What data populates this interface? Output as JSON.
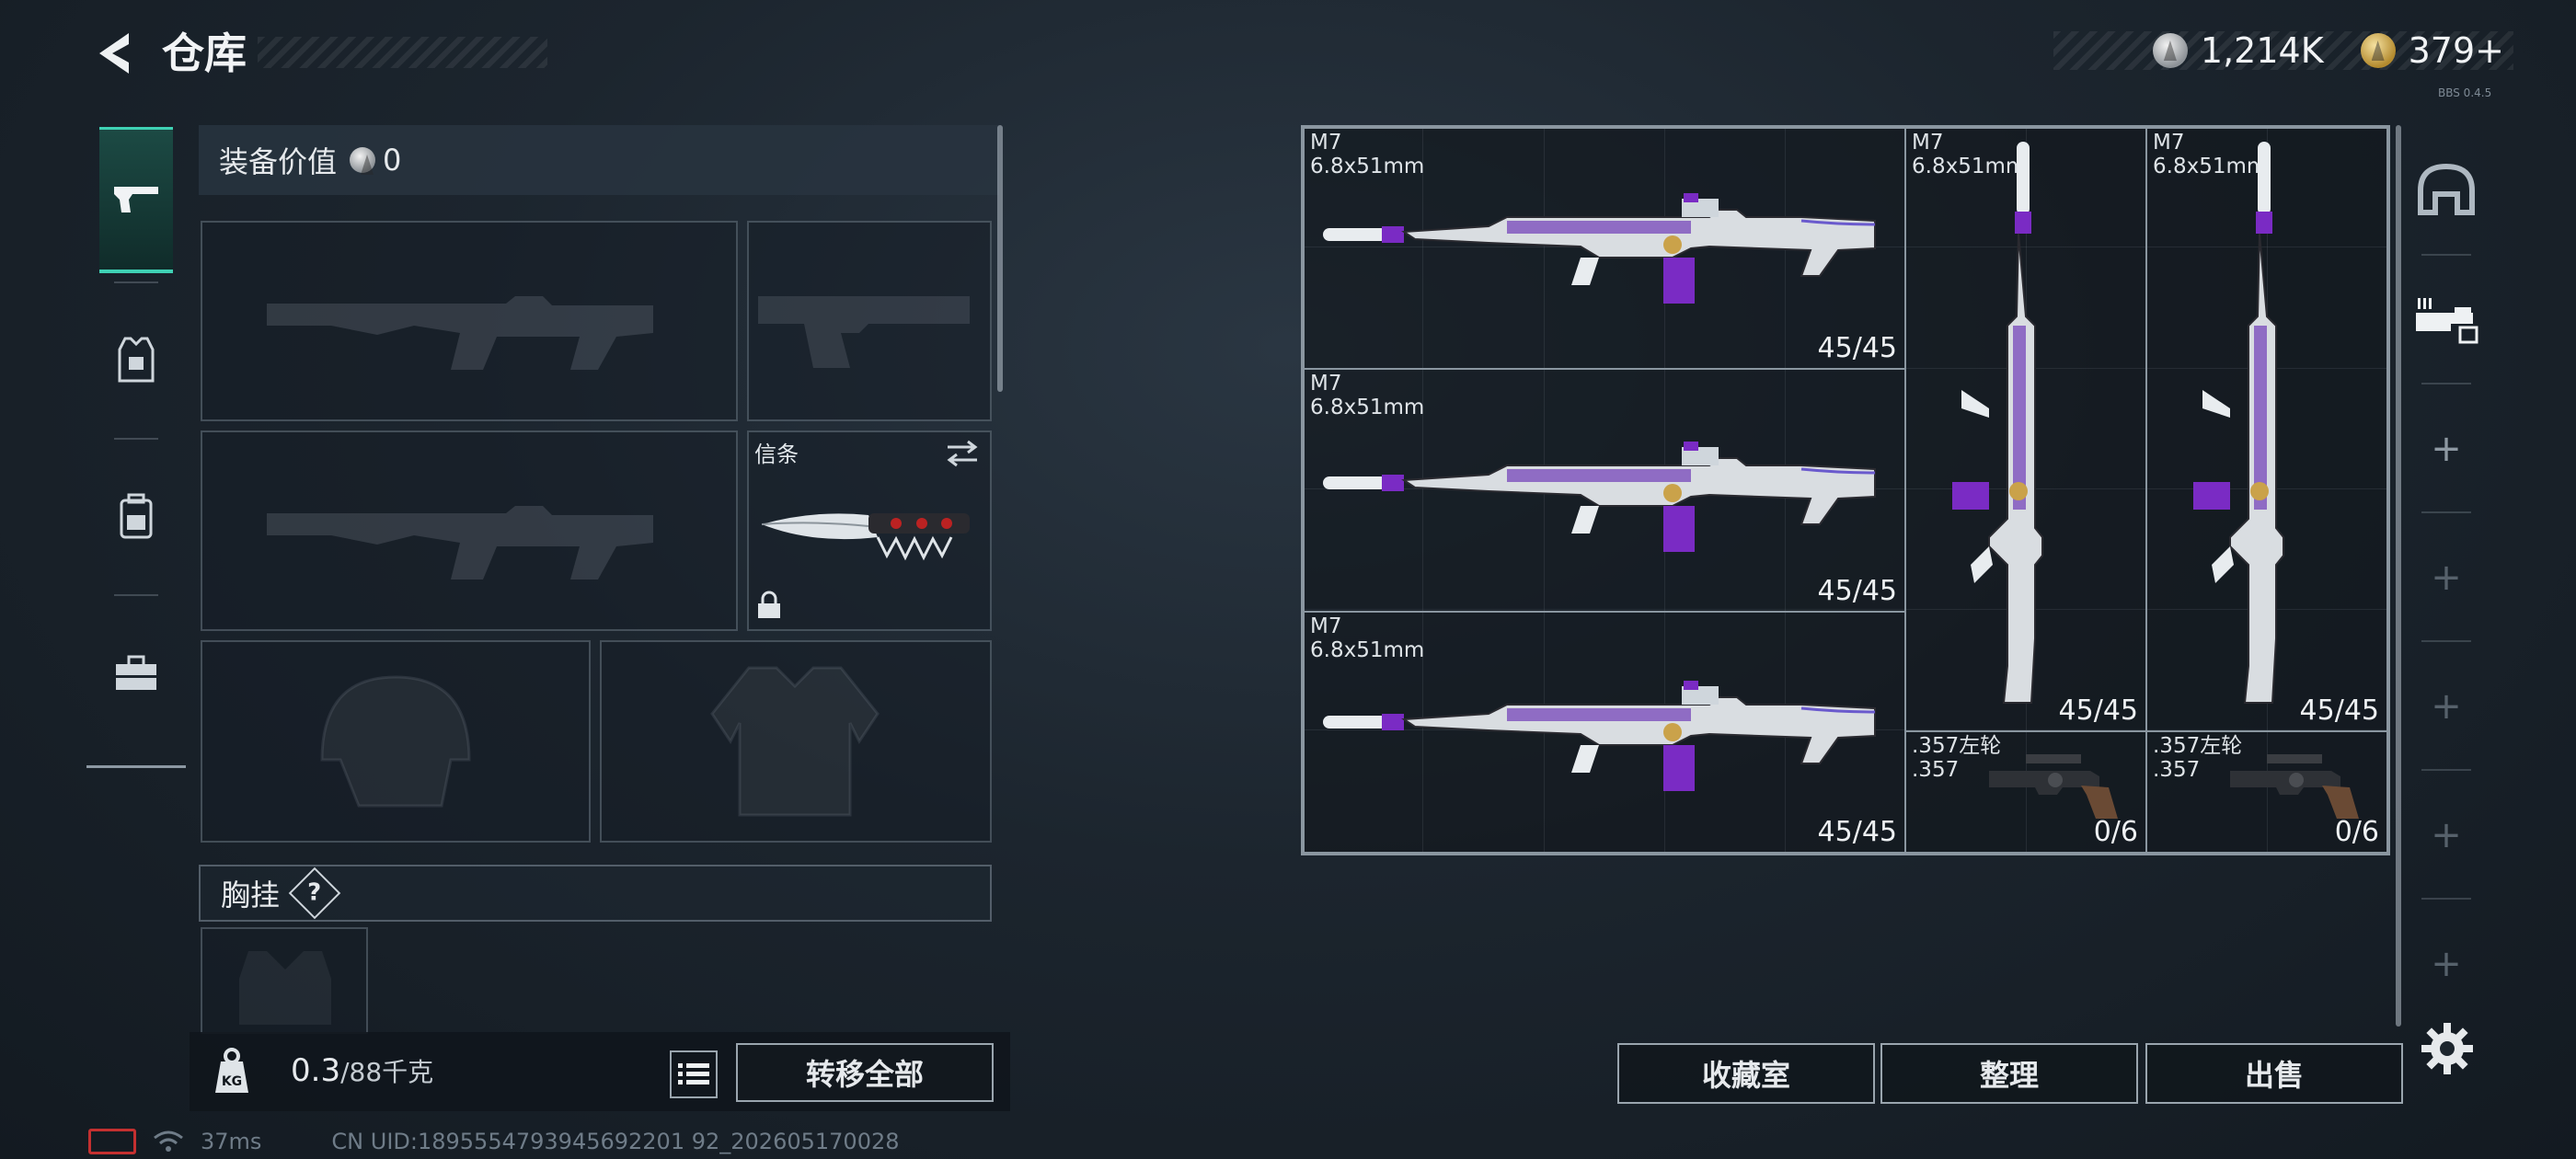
{
  "header": {
    "title": "仓库",
    "currencies": [
      {
        "icon": "silver-coin-icon",
        "value": "1,214K"
      },
      {
        "icon": "gold-coin-icon",
        "value": "379+"
      }
    ],
    "version": "BBS 0.4.5"
  },
  "left_rail": {
    "items": [
      {
        "name": "weapons",
        "icon": "pistol-icon",
        "active": true
      },
      {
        "name": "armor",
        "icon": "armor-vest-icon",
        "active": false
      },
      {
        "name": "backpack",
        "icon": "backpack-icon",
        "active": false
      },
      {
        "name": "tools",
        "icon": "toolbox-icon",
        "active": false
      }
    ]
  },
  "loadout": {
    "equipment_value_label": "装备价值",
    "equipment_value": "0",
    "melee_slot": {
      "label": "信条"
    },
    "chest_rig_label": "胸挂",
    "help_mark": "?",
    "weight_value": "0.3",
    "weight_max": "/88千克",
    "transfer_all_label": "转移全部"
  },
  "stash": {
    "items": [
      {
        "name": "M7",
        "caliber": "6.8x51mm",
        "ammo": "45/45",
        "orientation": "horizontal"
      },
      {
        "name": "M7",
        "caliber": "6.8x51mm",
        "ammo": "45/45",
        "orientation": "horizontal"
      },
      {
        "name": "M7",
        "caliber": "6.8x51mm",
        "ammo": "45/45",
        "orientation": "horizontal"
      },
      {
        "name": "M7",
        "caliber": "6.8x51mm",
        "ammo": "45/45",
        "orientation": "vertical"
      },
      {
        "name": "M7",
        "caliber": "6.8x51mm",
        "ammo": "45/45",
        "orientation": "vertical"
      },
      {
        "name": ".357左轮",
        "caliber": ".357",
        "ammo": "0/6",
        "orientation": "horizontal"
      },
      {
        "name": ".357左轮",
        "caliber": ".357",
        "ammo": "0/6",
        "orientation": "horizontal"
      }
    ]
  },
  "right_rail": {
    "items": [
      {
        "icon": "helmet-silhouette-icon"
      },
      {
        "icon": "weapon-rack-icon",
        "active": true
      },
      {
        "icon": "plus-icon",
        "label": "+"
      },
      {
        "icon": "plus-icon",
        "label": "+"
      },
      {
        "icon": "plus-icon",
        "label": "+"
      },
      {
        "icon": "plus-icon",
        "label": "+"
      },
      {
        "icon": "plus-icon",
        "label": "+"
      }
    ]
  },
  "actions": {
    "collection_label": "收藏室",
    "sort_label": "整理",
    "sell_label": "出售"
  },
  "status": {
    "ping": "37ms",
    "uid": "CN UID:1895554793945692201 92_202605170028"
  },
  "colors": {
    "accent_teal": "#3fd1b4",
    "weapon_purple": "#7a2bc4",
    "battery_red": "#c43030"
  }
}
